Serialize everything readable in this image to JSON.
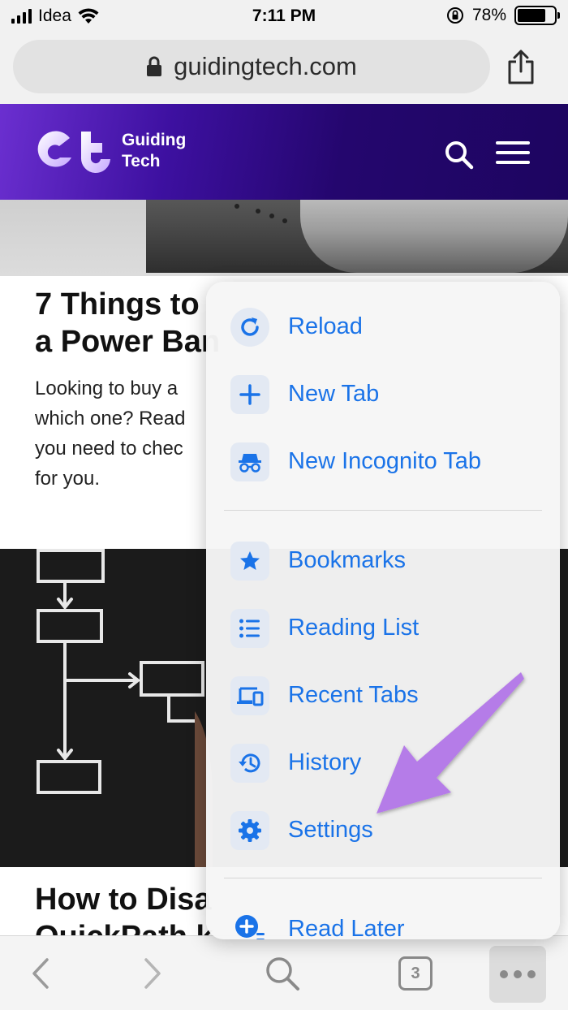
{
  "status_bar": {
    "carrier": "Idea",
    "time": "7:11 PM",
    "battery": "78%",
    "battery_level": 0.78
  },
  "address_bar": {
    "url": "guidingtech.com"
  },
  "site_header": {
    "logo_text": "Guiding\nTech"
  },
  "article": {
    "title": "7 Things to\na Power Ban",
    "excerpt": "Looking to buy a\nwhich one? Read\nyou need to chec\nfor you."
  },
  "article2": {
    "title": "How to Disa\nQuickPath k"
  },
  "menu": {
    "items": [
      {
        "label": "Reload",
        "icon": "reload-icon"
      },
      {
        "label": "New Tab",
        "icon": "plus-icon"
      },
      {
        "label": "New Incognito Tab",
        "icon": "incognito-icon"
      },
      {
        "label": "Bookmarks",
        "icon": "star-icon"
      },
      {
        "label": "Reading List",
        "icon": "list-icon"
      },
      {
        "label": "Recent Tabs",
        "icon": "devices-icon"
      },
      {
        "label": "History",
        "icon": "history-icon"
      },
      {
        "label": "Settings",
        "icon": "gear-icon"
      },
      {
        "label": "Read Later",
        "icon": "add-circle-icon"
      }
    ]
  },
  "toolbar": {
    "tab_count": "3"
  },
  "colors": {
    "accent": "#1a73e8",
    "header_purple": "#24066e",
    "arrow": "#b57be8"
  }
}
